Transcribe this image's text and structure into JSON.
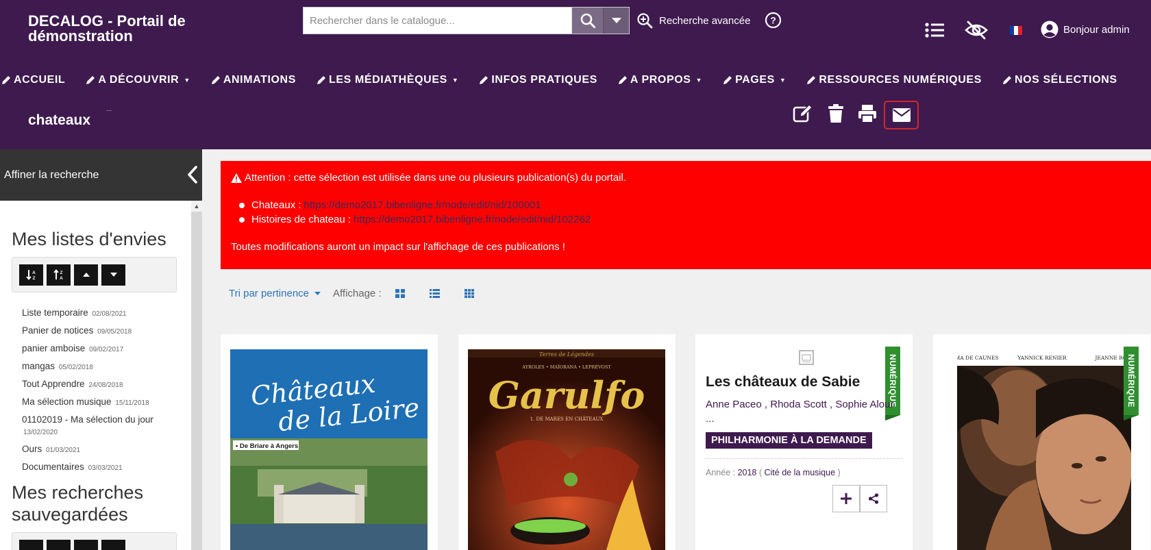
{
  "header": {
    "site_title": "DECALOG - Portail de démonstration",
    "search_placeholder": "Rechercher dans le catalogue...",
    "advanced_search": "Recherche avancée",
    "user_greeting": "Bonjour admin",
    "language": "fr"
  },
  "nav": {
    "items": [
      {
        "label": "ACCUEIL",
        "dropdown": false
      },
      {
        "label": "A DÉCOUVRIR",
        "dropdown": true
      },
      {
        "label": "ANIMATIONS",
        "dropdown": false
      },
      {
        "label": "LES MÉDIATHÈQUES",
        "dropdown": true
      },
      {
        "label": "INFOS PRATIQUES",
        "dropdown": false
      },
      {
        "label": "A PROPOS",
        "dropdown": true
      },
      {
        "label": "PAGES",
        "dropdown": true
      },
      {
        "label": "RESSOURCES NUMÉRIQUES",
        "dropdown": false
      },
      {
        "label": "NOS SÉLECTIONS",
        "dropdown": false
      }
    ]
  },
  "selection": {
    "title": "chateaux",
    "title_mark": "..."
  },
  "sidebar": {
    "header": "Affiner la recherche",
    "wishlists_title": "Mes listes d'envies",
    "wishlists": [
      {
        "name": "Liste temporaire",
        "date": "02/08/2021"
      },
      {
        "name": "Panier de notices",
        "date": "09/05/2018"
      },
      {
        "name": "panier amboise",
        "date": "09/02/2017"
      },
      {
        "name": "mangas",
        "date": "05/02/2018"
      },
      {
        "name": "Tout Apprendre",
        "date": "24/08/2018"
      },
      {
        "name": "Ma sélection musique",
        "date": "15/11/2018"
      },
      {
        "name": "01102019 - Ma sélection du jour",
        "date": "13/02/2020"
      },
      {
        "name": "Ours",
        "date": "01/03/2021"
      },
      {
        "name": "Documentaires",
        "date": "03/03/2021"
      }
    ],
    "saved_searches_title": "Mes recherches sauvegardées"
  },
  "alert": {
    "title": "Attention : cette sélection est utilisée dans une ou plusieurs publication(s) du portail.",
    "links": [
      {
        "label": "Chateaux :",
        "url": "https://demo2017.bibenligne.fr/node/edit/nid/100001"
      },
      {
        "label": "Histoires de chateau :",
        "url": "https://demo2017.bibenligne.fr/node/edit/nid/102262"
      }
    ],
    "footer": "Toutes modifications auront un impact sur l'affichage de ces publications !"
  },
  "toolbar": {
    "sort_label": "Tri par pertinence",
    "display_label": "Affichage :"
  },
  "cards": [
    {
      "cover_title_line1": "Châteaux",
      "cover_title_line2": "de la Loire",
      "cover_subtitle": "• De Briare à Angers"
    },
    {
      "cover_series": "Terres de Légendes",
      "cover_authors": "AYROLES • MAÏORANA • LEPRÉVOST",
      "cover_title": "Garulfo",
      "cover_subtitle": "1. DE MARES EN CHÂTEAUX"
    },
    {
      "badge": "NUMÉRIQUE",
      "title": "Les châteaux de Sabie",
      "authors": [
        "Anne Paceo",
        "Rhoda Scott",
        "Sophie Alour"
      ],
      "authors_more": "...",
      "tag": "PHILHARMONIE À LA DEMANDE",
      "year_label": "Année :",
      "year": "2018",
      "publisher": "Cité de la musique"
    },
    {
      "badge": "NUMÉRIQUE",
      "cover_credits": [
        "EMMA DE CAUNES",
        "YANNICK RENIER",
        "JEANNE ROSA"
      ]
    }
  ],
  "colors": {
    "header_bg": "#3e1a4e",
    "alert_bg": "#ff0000",
    "badge_green": "#2f8f2f",
    "link_blue": "#2d72b8"
  }
}
